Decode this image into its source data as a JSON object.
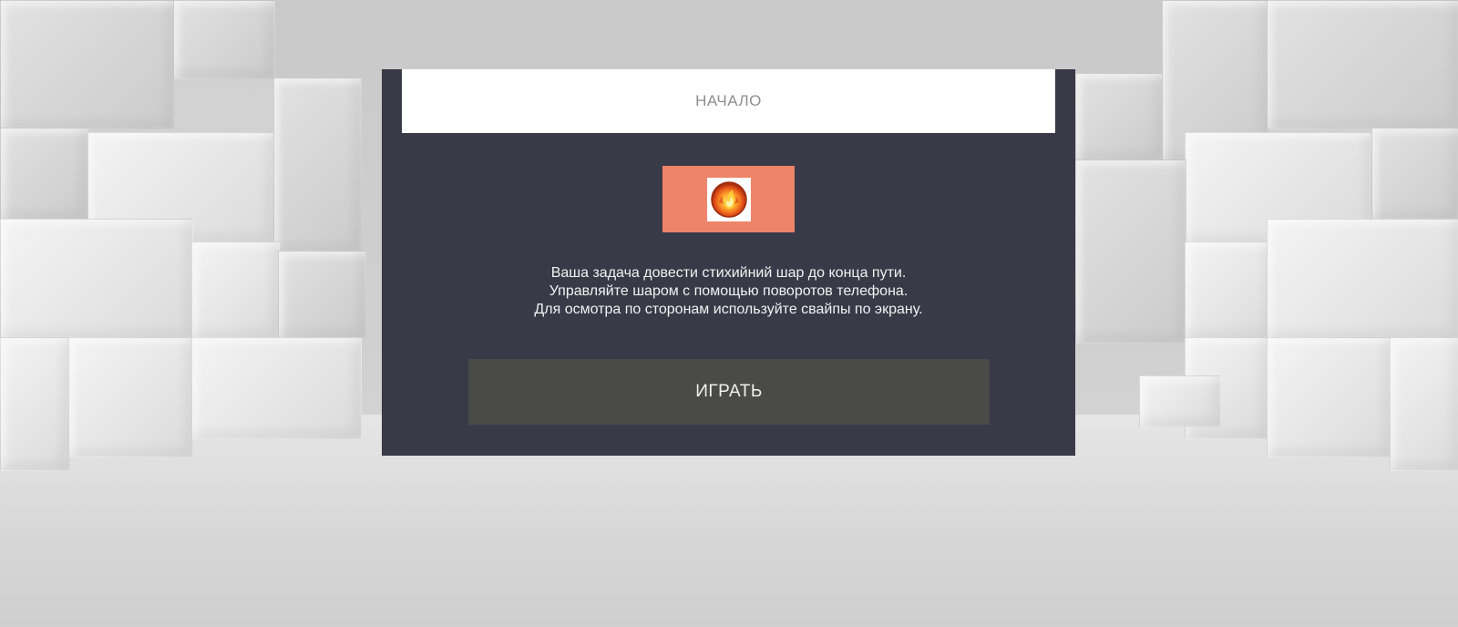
{
  "dialog": {
    "title": "НАЧАЛО",
    "ball_icon": "fire-elemental-ball-icon",
    "instructions": [
      "Ваша задача довести стихийний шар до конца пути.",
      "Управляйте шаром с помощью поворотов телефона.",
      "Для осмотра по сторонам используйте свайпы по экрану."
    ],
    "play_label": "ИГРАТЬ"
  },
  "colors": {
    "panel_background": "#393a48",
    "header_background": "#ffffff",
    "ball_tile": "#ee8469",
    "play_button": "#4a4a48"
  }
}
